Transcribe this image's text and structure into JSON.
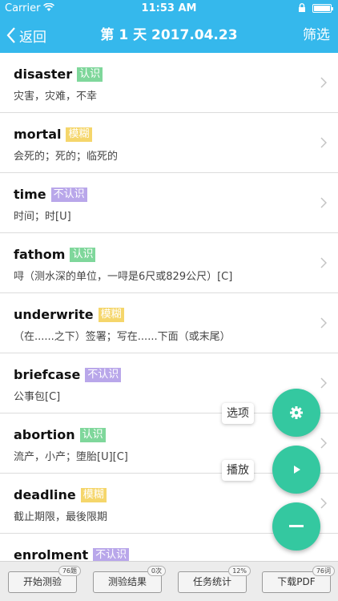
{
  "status_bar": {
    "carrier": "Carrier",
    "time": "11:53 AM"
  },
  "nav": {
    "back_label": "返回",
    "title": "第 1 天 2017.04.23",
    "filter_label": "筛选"
  },
  "words": [
    {
      "word": "disaster",
      "tag": "认识",
      "status": "know",
      "meaning": "灾害，灾难，不幸"
    },
    {
      "word": "mortal",
      "tag": "模糊",
      "status": "vague",
      "meaning": "会死的；死的；临死的"
    },
    {
      "word": "time",
      "tag": "不认识",
      "status": "unknown",
      "meaning": "时间；时[U]"
    },
    {
      "word": "fathom",
      "tag": "认识",
      "status": "know",
      "meaning": "㖊（测水深的单位，一㖊是6尺或829公尺）[C]"
    },
    {
      "word": "underwrite",
      "tag": "模糊",
      "status": "vague",
      "meaning": "（在......之下）签署；写在......下面（或末尾）"
    },
    {
      "word": "briefcase",
      "tag": "不认识",
      "status": "unknown",
      "meaning": "公事包[C]"
    },
    {
      "word": "abortion",
      "tag": "认识",
      "status": "know",
      "meaning": "流产，小产；堕胎[U][C]"
    },
    {
      "word": "deadline",
      "tag": "模糊",
      "status": "vague",
      "meaning": "截止期限，最後限期"
    },
    {
      "word": "enrolment",
      "tag": "不认识",
      "status": "unknown",
      "meaning": ""
    }
  ],
  "fab": {
    "options_label": "选项",
    "play_label": "播放"
  },
  "bottom_bar": {
    "start_quiz": {
      "label": "开始测验",
      "badge": "76题"
    },
    "quiz_result": {
      "label": "测验结果",
      "badge": "0次"
    },
    "task_stats": {
      "label": "任务统计",
      "badge": "12%"
    },
    "download_pdf": {
      "label": "下载PDF",
      "badge": "76词"
    }
  },
  "colors": {
    "accent": "#35b8ec",
    "fab": "#34c8a0",
    "know": "#7fd79b",
    "vague": "#f5d66b",
    "unknown": "#b9a7ea"
  }
}
